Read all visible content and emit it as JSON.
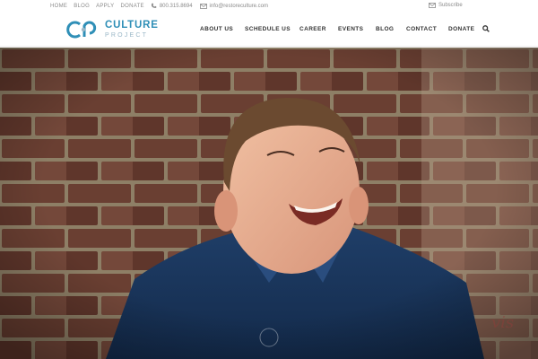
{
  "topbar": {
    "links": [
      "HOME",
      "BLOG",
      "APPLY",
      "DONATE"
    ],
    "phone": "800.315.8694",
    "email": "info@restoreculture.com",
    "subscribe": "Subscribe",
    "phone_icon": "phone-icon",
    "email_icon": "envelope-icon",
    "subscribe_icon": "envelope-icon"
  },
  "header": {
    "logo_word1": "CULTURE",
    "logo_word2": "PROJECT",
    "nav": [
      "ABOUT US",
      "SCHEDULE US",
      "CAREER",
      "EVENTS",
      "BLOG",
      "CONTACT",
      "DONATE"
    ],
    "search_icon": "search-icon"
  },
  "colors": {
    "brand": "#2f8fb7",
    "nav_text": "#333333",
    "utility_text": "#8a8a8a"
  },
  "hero": {
    "image": "smiling man in blue denim shirt in front of brick wall",
    "slider_indicator": "circle-icon"
  }
}
